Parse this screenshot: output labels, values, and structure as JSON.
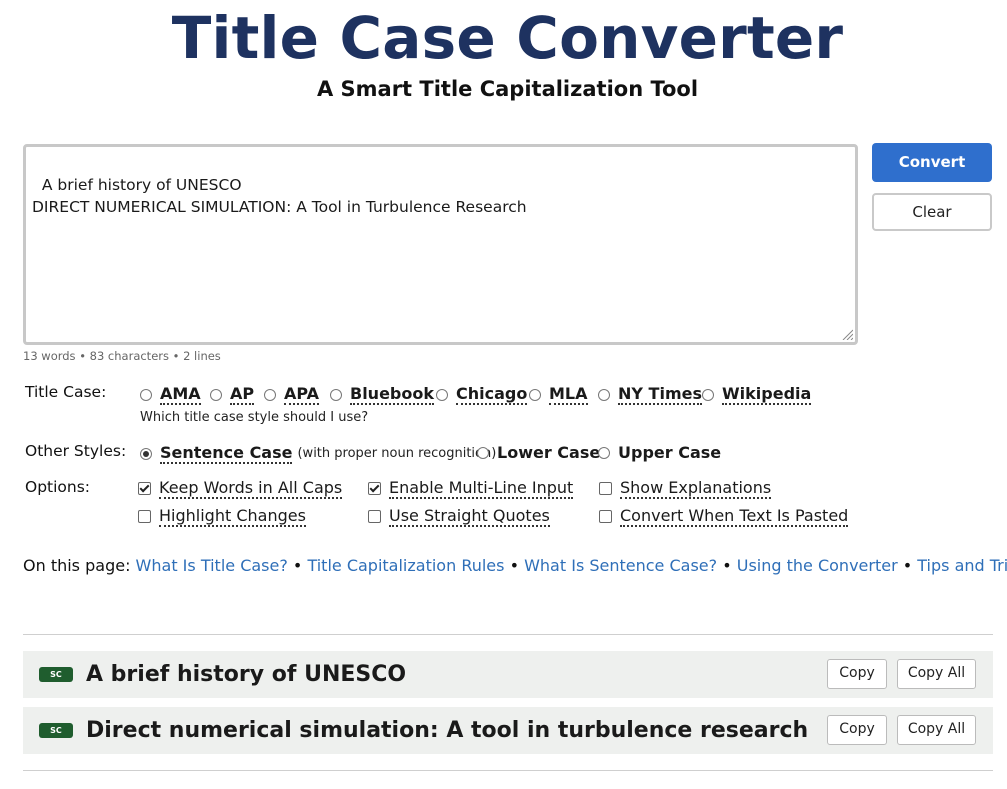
{
  "header": {
    "title": "Title Case Converter",
    "subtitle": "A Smart Title Capitalization Tool"
  },
  "input": {
    "value": "A brief history of UNESCO\nDIRECT NUMERICAL SIMULATION: A Tool in Turbulence Research",
    "stats": "13 words • 83 characters • 2 lines"
  },
  "buttons": {
    "convert": "Convert",
    "clear": "Clear"
  },
  "title_case": {
    "label": "Title Case:",
    "options": [
      "AMA",
      "AP",
      "APA",
      "Bluebook",
      "Chicago",
      "MLA",
      "NY Times",
      "Wikipedia"
    ],
    "help_text": "Which title case style should I use?"
  },
  "other_styles": {
    "label": "Other Styles:",
    "options": [
      {
        "label": "Sentence Case",
        "hint": "(with proper noun recognition)",
        "selected": true
      },
      {
        "label": "Lower Case",
        "selected": false
      },
      {
        "label": "Upper Case",
        "selected": false
      }
    ]
  },
  "options": {
    "label": "Options:",
    "items": [
      {
        "label": "Keep Words in All Caps",
        "checked": true
      },
      {
        "label": "Enable Multi-Line Input",
        "checked": true
      },
      {
        "label": "Show Explanations",
        "checked": false
      },
      {
        "label": "Highlight Changes",
        "checked": false
      },
      {
        "label": "Use Straight Quotes",
        "checked": false
      },
      {
        "label": "Convert When Text Is Pasted",
        "checked": false
      }
    ]
  },
  "on_this_page": {
    "label": "On this page:",
    "links": [
      "What Is Title Case?",
      "Title Capitalization Rules",
      "What Is Sentence Case?",
      "Using the Converter",
      "Tips and Tricks"
    ],
    "separator": " • "
  },
  "results": [
    {
      "badge": "SC",
      "text": "A brief history of UNESCO",
      "copy": "Copy",
      "copy_all": "Copy All"
    },
    {
      "badge": "SC",
      "text": "Direct numerical simulation: A tool in turbulence research",
      "copy": "Copy",
      "copy_all": "Copy All"
    }
  ],
  "colors": {
    "title": "#1e3260",
    "accent": "#2f6fcd",
    "link": "#2f6fb8",
    "badge": "#1f5d2e",
    "result_bg": "#eef0ee"
  }
}
